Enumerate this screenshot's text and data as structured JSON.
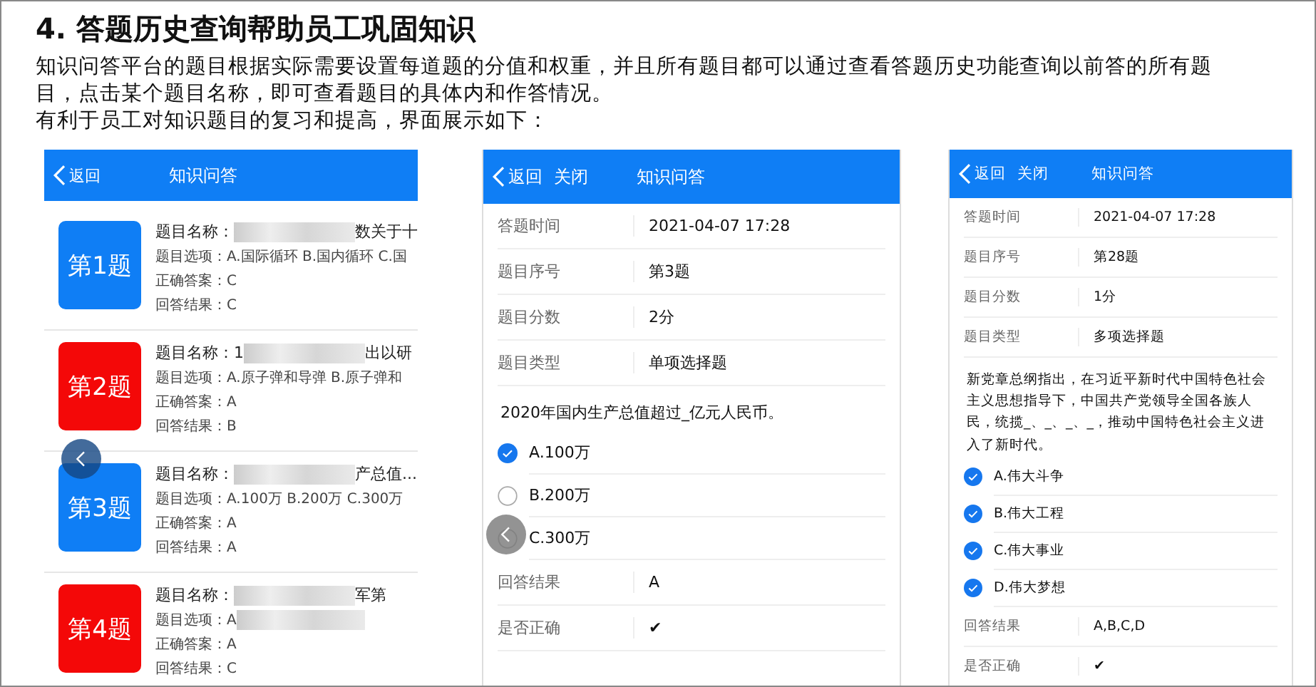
{
  "heading": "4. 答题历史查询帮助员工巩固知识",
  "paragraphs": [
    "知识问答平台的题目根据实际需要设置每道题的分值和权重，并且所有题目都可以通过查看答题历史功能查询以前答的所有题目，点击某个题目名称，即可查看题目的具体内和作答情况。",
    "有利于员工对知识题目的复习和提高，界面展示如下："
  ],
  "screens": [
    {
      "kind": "list",
      "header": {
        "back": "返回",
        "title": "知识问答"
      },
      "floating_back": true,
      "items": [
        {
          "badge": "第1题",
          "correct": true,
          "fields": [
            {
              "label": "题目名称：",
              "blurred": true,
              "after": "数关于十"
            },
            {
              "label": "题目选项：",
              "before": "A.国际循环 B.国内循环 C.国"
            },
            {
              "label": "正确答案：",
              "before": "C"
            },
            {
              "label": "回答结果：",
              "before": "C"
            }
          ]
        },
        {
          "badge": "第2题",
          "correct": false,
          "fields": [
            {
              "label": "题目名称：",
              "before": "1",
              "blurred": true,
              "after": "出以研"
            },
            {
              "label": "题目选项：",
              "before": "A.原子弹和导弹 B.原子弹和"
            },
            {
              "label": "正确答案：",
              "before": "A"
            },
            {
              "label": "回答结果：",
              "before": "B"
            }
          ]
        },
        {
          "badge": "第3题",
          "correct": true,
          "fields": [
            {
              "label": "题目名称：",
              "blurred": true,
              "after": "产总值..."
            },
            {
              "label": "题目选项：",
              "before": "A.100万 B.200万 C.300万"
            },
            {
              "label": "正确答案：",
              "before": "A"
            },
            {
              "label": "回答结果：",
              "before": "A"
            }
          ]
        },
        {
          "badge": "第4题",
          "correct": false,
          "fields": [
            {
              "label": "题目名称：",
              "blurred": true,
              "after": "军第"
            },
            {
              "label": "题目选项：",
              "before": "A",
              "blurred": true
            },
            {
              "label": "正确答案：",
              "before": "A"
            },
            {
              "label": "回答结果：",
              "before": "C"
            }
          ]
        }
      ]
    },
    {
      "kind": "detail",
      "header": {
        "back": "返回",
        "close": "关闭",
        "title": "知识问答"
      },
      "floating_back": true,
      "info": [
        {
          "label": "答题时间",
          "value": "2021-04-07 17:28"
        },
        {
          "label": "题目序号",
          "value": "第3题"
        },
        {
          "label": "题目分数",
          "value": "2分"
        },
        {
          "label": "题目类型",
          "value": "单项选择题"
        }
      ],
      "question": "2020年国内生产总值超过_亿元人民币。",
      "options": [
        {
          "label": "A.100万",
          "selected": true
        },
        {
          "label": "B.200万",
          "selected": false
        },
        {
          "label": "C.300万",
          "selected": false
        }
      ],
      "results": [
        {
          "label": "回答结果",
          "value": "A"
        },
        {
          "label": "是否正确",
          "value": "✔"
        }
      ]
    },
    {
      "kind": "detail",
      "header": {
        "back": "返回",
        "close": "关闭",
        "title": "知识问答"
      },
      "info": [
        {
          "label": "答题时间",
          "value": "2021-04-07 17:28"
        },
        {
          "label": "题目序号",
          "value": "第28题"
        },
        {
          "label": "题目分数",
          "value": "1分"
        },
        {
          "label": "题目类型",
          "value": "多项选择题"
        }
      ],
      "question": "新党章总纲指出，在习近平新时代中国特色社会主义思想指导下，中国共产党领导全国各族人民，统揽_、_、_、_，推动中国特色社会主义进入了新时代。",
      "options": [
        {
          "label": "A.伟大斗争",
          "selected": true
        },
        {
          "label": "B.伟大工程",
          "selected": true
        },
        {
          "label": "C.伟大事业",
          "selected": true
        },
        {
          "label": "D.伟大梦想",
          "selected": true
        }
      ],
      "results": [
        {
          "label": "回答结果",
          "value": "A,B,C,D"
        },
        {
          "label": "是否正确",
          "value": "✔"
        }
      ]
    }
  ]
}
